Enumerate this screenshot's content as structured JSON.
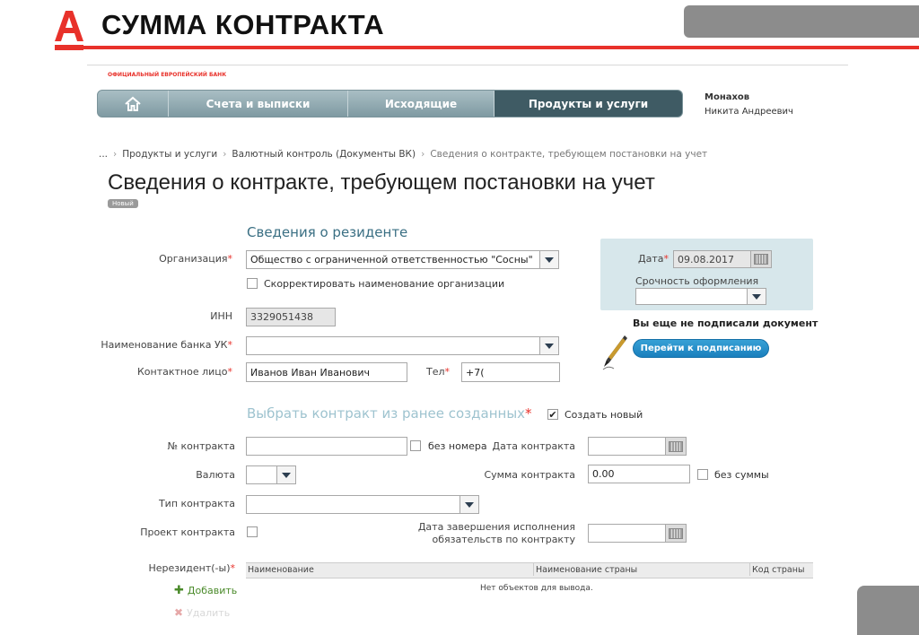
{
  "slide": {
    "title": "СУММА КОНТРАКТА",
    "brand_color": "#e8312a"
  },
  "bank": {
    "tagline": "ОФИЦИАЛЬНЫЙ ЕВРОПЕЙСКИЙ БАНК"
  },
  "nav": {
    "items": [
      {
        "label": "Счета и выписки"
      },
      {
        "label": "Исходящие"
      },
      {
        "label": "Продукты и услуги"
      }
    ],
    "home_icon": "home-icon"
  },
  "user": {
    "last_name": "Монахов",
    "first_names": "Никита Андреевич"
  },
  "breadcrumb": {
    "ellipsis": "...",
    "sep": "›",
    "items": [
      "Продукты и услуги",
      "Валютный контроль (Документы ВК)",
      "Сведения о контракте, требующем постановки на учет"
    ]
  },
  "page": {
    "title": "Сведения о контракте, требующем постановки на учет",
    "badge": "Новый"
  },
  "resident": {
    "section_title": "Сведения о резиденте",
    "org_label": "Организация",
    "org_value": "Общество с ограниченной ответственностью \"Сосны\"",
    "correct_name_label": "Скорректировать наименование организации",
    "inn_label": "ИНН",
    "inn_value": "3329051438",
    "bank_label": "Наименование банка УК",
    "bank_value": "",
    "contact_label": "Контактное лицо",
    "contact_value": "Иванов Иван Иванович",
    "phone_label": "Тел",
    "phone_value": "+7("
  },
  "sign": {
    "date_label": "Дата",
    "date_value": "09.08.2017",
    "urgency_label": "Срочность оформления",
    "urgency_value": "",
    "not_signed": "Вы еще не подписали документ",
    "sign_button": "Перейти к подписанию"
  },
  "contract": {
    "section_title": "Выбрать контракт из ранее созданных",
    "create_new_label": "Создать новый",
    "create_new_checked": true,
    "number_label": "№ контракта",
    "number_value": "",
    "no_number_label": "без номера",
    "date_label": "Дата контракта",
    "date_value": "",
    "currency_label": "Валюта",
    "currency_value": "",
    "sum_label": "Сумма контракта",
    "sum_value": "0.00",
    "no_sum_label": "без суммы",
    "type_label": "Тип контракта",
    "type_value": "",
    "project_label": "Проект контракта",
    "end_date_label_1": "Дата завершения исполнения",
    "end_date_label_2": "обязательств по контракту",
    "end_date_value": ""
  },
  "nonresident": {
    "label": "Нерезидент(-ы)",
    "columns": [
      "Наименование",
      "Наименование страны",
      "Код страны"
    ],
    "empty_text": "Нет объектов для вывода.",
    "add_label": "Добавить",
    "delete_label": "Удалить"
  },
  "colors": {
    "nav_active": "#3f5b64",
    "nav": "#8ea7ae",
    "section": "#3a6f83",
    "panel": "#d7e7eb",
    "button": "#1a7fbd",
    "add": "#4a8a2a"
  }
}
